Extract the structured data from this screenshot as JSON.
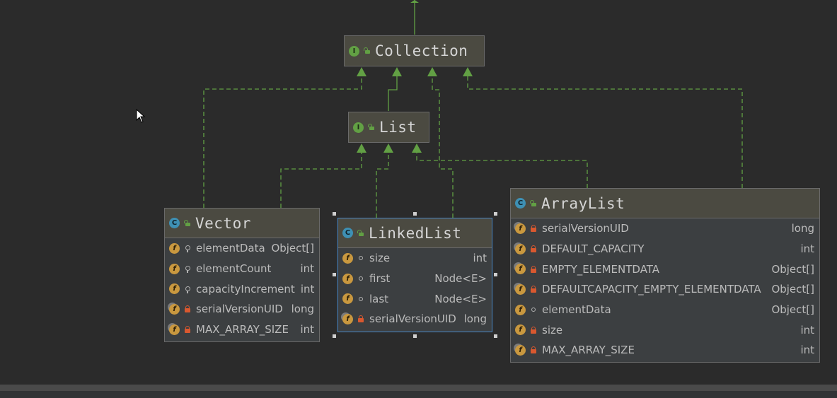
{
  "colors": {
    "background": "#2b2b2b",
    "edge": "#62a044",
    "selection": "#4a88c7"
  },
  "nodes": {
    "collection": {
      "kind": "interface",
      "kind_icon": "I",
      "name": "Collection",
      "visibility": "public"
    },
    "list": {
      "kind": "interface",
      "kind_icon": "I",
      "name": "List",
      "visibility": "public"
    },
    "vector": {
      "kind": "class",
      "kind_icon": "C",
      "name": "Vector",
      "visibility": "public",
      "fields": [
        {
          "icon": "f",
          "static": false,
          "visibility": "protected",
          "name": "elementData",
          "type": "Object[]"
        },
        {
          "icon": "f",
          "static": false,
          "visibility": "protected",
          "name": "elementCount",
          "type": "int"
        },
        {
          "icon": "f",
          "static": false,
          "visibility": "protected",
          "name": "capacityIncrement",
          "type": "int"
        },
        {
          "icon": "f",
          "static": true,
          "visibility": "private",
          "name": "serialVersionUID",
          "type": "long"
        },
        {
          "icon": "f",
          "static": true,
          "visibility": "private",
          "name": "MAX_ARRAY_SIZE",
          "type": "int"
        }
      ]
    },
    "linkedlist": {
      "kind": "class",
      "kind_icon": "C",
      "name": "LinkedList",
      "visibility": "public",
      "selected": true,
      "fields": [
        {
          "icon": "f",
          "static": false,
          "visibility": "package",
          "name": "size",
          "type": "int"
        },
        {
          "icon": "f",
          "static": false,
          "visibility": "package",
          "name": "first",
          "type": "Node<E>"
        },
        {
          "icon": "f",
          "static": false,
          "visibility": "package",
          "name": "last",
          "type": "Node<E>"
        },
        {
          "icon": "f",
          "static": true,
          "visibility": "private",
          "name": "serialVersionUID",
          "type": "long"
        }
      ]
    },
    "arraylist": {
      "kind": "class",
      "kind_icon": "C",
      "name": "ArrayList",
      "visibility": "public",
      "fields": [
        {
          "icon": "f",
          "static": true,
          "visibility": "private",
          "name": "serialVersionUID",
          "type": "long"
        },
        {
          "icon": "f",
          "static": true,
          "visibility": "private",
          "name": "DEFAULT_CAPACITY",
          "type": "int"
        },
        {
          "icon": "f",
          "static": true,
          "visibility": "private",
          "name": "EMPTY_ELEMENTDATA",
          "type": "Object[]"
        },
        {
          "icon": "f",
          "static": true,
          "visibility": "private",
          "name": "DEFAULTCAPACITY_EMPTY_ELEMENTDATA",
          "type": "Object[]"
        },
        {
          "icon": "f",
          "static": false,
          "visibility": "package",
          "name": "elementData",
          "type": "Object[]"
        },
        {
          "icon": "f",
          "static": false,
          "visibility": "private",
          "name": "size",
          "type": "int"
        },
        {
          "icon": "f",
          "static": true,
          "visibility": "private",
          "name": "MAX_ARRAY_SIZE",
          "type": "int"
        }
      ]
    }
  },
  "edges": [
    {
      "from": "collection",
      "to": "iterable",
      "style": "solid"
    },
    {
      "from": "list",
      "to": "collection",
      "style": "solid"
    },
    {
      "from": "vector",
      "to": "collection",
      "style": "dashed"
    },
    {
      "from": "vector",
      "to": "list",
      "style": "dashed"
    },
    {
      "from": "linkedlist",
      "to": "list",
      "style": "dashed"
    },
    {
      "from": "linkedlist",
      "to": "collection",
      "style": "dashed"
    },
    {
      "from": "arraylist",
      "to": "list",
      "style": "dashed"
    },
    {
      "from": "arraylist",
      "to": "collection",
      "style": "dashed"
    }
  ]
}
